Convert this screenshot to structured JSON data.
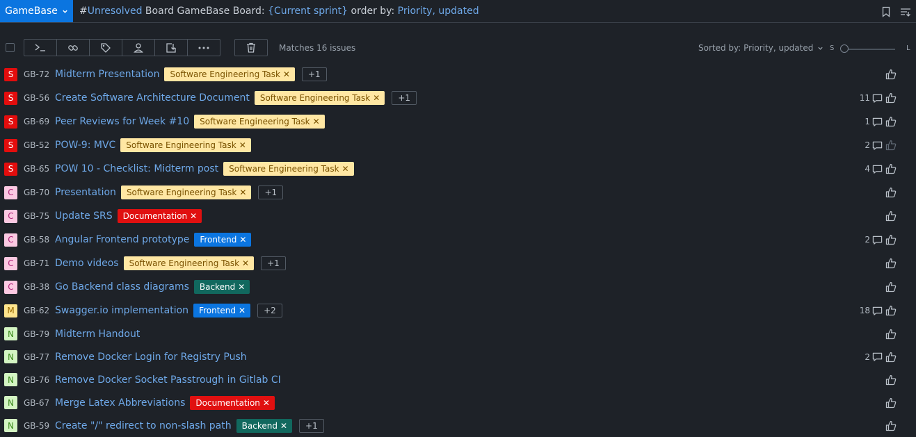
{
  "header": {
    "project_label": "GameBase",
    "query_parts": [
      {
        "text": "#",
        "kw": false
      },
      {
        "text": "Unresolved",
        "kw": true
      },
      {
        "text": " Board GameBase Board: ",
        "kw": false
      },
      {
        "text": "{Current sprint}",
        "kw": true
      },
      {
        "text": " order by: ",
        "kw": false
      },
      {
        "text": "Priority, updated",
        "kw": true
      }
    ]
  },
  "toolbar": {
    "matches": "Matches 16 issues",
    "sorted": "Sorted by: Priority, updated",
    "size_small": "S",
    "size_large": "L"
  },
  "issues": [
    {
      "prio": "S",
      "id": "GB-72",
      "summary": "Midterm Presentation",
      "tag": "Software Engineering Task",
      "tag_type": "set",
      "more": "+1",
      "comments": "",
      "vote_dim": false
    },
    {
      "prio": "S",
      "id": "GB-56",
      "summary": "Create Software Architecture Document",
      "tag": "Software Engineering Task",
      "tag_type": "set",
      "more": "+1",
      "comments": "11",
      "vote_dim": false
    },
    {
      "prio": "S",
      "id": "GB-69",
      "summary": "Peer Reviews for Week #10",
      "tag": "Software Engineering Task",
      "tag_type": "set",
      "more": "",
      "comments": "1",
      "vote_dim": false
    },
    {
      "prio": "S",
      "id": "GB-52",
      "summary": "POW-9: MVC",
      "tag": "Software Engineering Task",
      "tag_type": "set",
      "more": "",
      "comments": "2",
      "vote_dim": true
    },
    {
      "prio": "S",
      "id": "GB-65",
      "summary": "POW 10 - Checklist: Midterm post",
      "tag": "Software Engineering Task",
      "tag_type": "set",
      "more": "",
      "comments": "4",
      "vote_dim": false
    },
    {
      "prio": "C",
      "id": "GB-70",
      "summary": "Presentation",
      "tag": "Software Engineering Task",
      "tag_type": "set",
      "more": "+1",
      "comments": "",
      "vote_dim": false
    },
    {
      "prio": "C",
      "id": "GB-75",
      "summary": "Update SRS",
      "tag": "Documentation",
      "tag_type": "doc",
      "more": "",
      "comments": "",
      "vote_dim": false
    },
    {
      "prio": "C",
      "id": "GB-58",
      "summary": "Angular Frontend prototype",
      "tag": "Frontend",
      "tag_type": "front",
      "more": "",
      "comments": "2",
      "vote_dim": false
    },
    {
      "prio": "C",
      "id": "GB-71",
      "summary": "Demo videos",
      "tag": "Software Engineering Task",
      "tag_type": "set",
      "more": "+1",
      "comments": "",
      "vote_dim": false
    },
    {
      "prio": "C",
      "id": "GB-38",
      "summary": "Go Backend class diagrams",
      "tag": "Backend",
      "tag_type": "back",
      "more": "",
      "comments": "",
      "vote_dim": false
    },
    {
      "prio": "M",
      "id": "GB-62",
      "summary": "Swagger.io implementation",
      "tag": "Frontend",
      "tag_type": "front",
      "more": "+2",
      "comments": "18",
      "vote_dim": false
    },
    {
      "prio": "N",
      "id": "GB-79",
      "summary": "Midterm Handout",
      "tag": "",
      "tag_type": "",
      "more": "",
      "comments": "",
      "vote_dim": false
    },
    {
      "prio": "N",
      "id": "GB-77",
      "summary": "Remove Docker Login for Registry Push",
      "tag": "",
      "tag_type": "",
      "more": "",
      "comments": "2",
      "vote_dim": false
    },
    {
      "prio": "N",
      "id": "GB-76",
      "summary": "Remove Docker Socket Passtrough in Gitlab CI",
      "tag": "",
      "tag_type": "",
      "more": "",
      "comments": "",
      "vote_dim": false
    },
    {
      "prio": "N",
      "id": "GB-67",
      "summary": "Merge Latex Abbreviations",
      "tag": "Documentation",
      "tag_type": "doc",
      "more": "",
      "comments": "",
      "vote_dim": false
    },
    {
      "prio": "N",
      "id": "GB-59",
      "summary": "Create \"/\" redirect to non-slash path",
      "tag": "Backend",
      "tag_type": "back",
      "more": "+1",
      "comments": "",
      "vote_dim": false
    }
  ],
  "colors": {
    "prio_S": {
      "bg": "#e30d0d",
      "fg": "#ffffff"
    },
    "prio_C": {
      "bg": "#fbc9e2",
      "fg": "#b0247a"
    },
    "prio_M": {
      "bg": "#fde48d",
      "fg": "#9a6a00"
    },
    "prio_N": {
      "bg": "#d4f5c3",
      "fg": "#3f8d1f"
    },
    "tag_set": {
      "bg": "#ffe7a3",
      "fg": "#7a5200"
    },
    "tag_doc": {
      "bg": "#e01010",
      "fg": "#ffffff"
    },
    "tag_front": {
      "bg": "#0b75e0",
      "fg": "#ffffff"
    },
    "tag_back": {
      "bg": "#11685e",
      "fg": "#ffffff"
    }
  }
}
